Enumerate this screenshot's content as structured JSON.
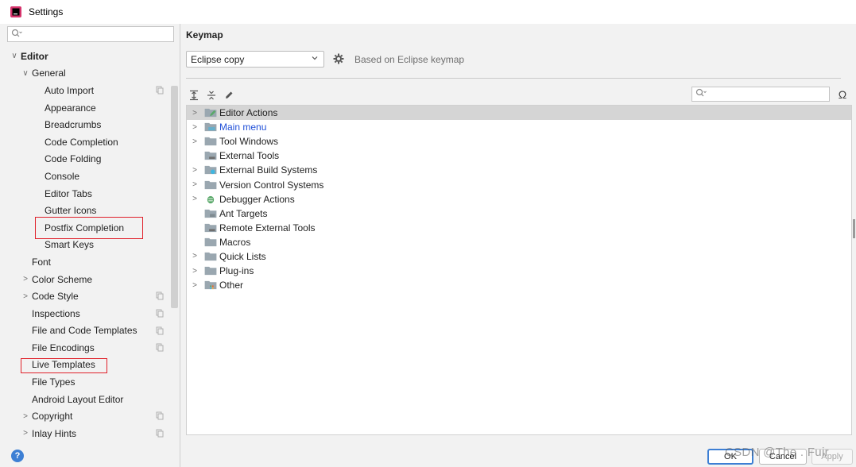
{
  "window": {
    "title": "Settings",
    "app_icon": "intellij-app-icon"
  },
  "left_panel": {
    "search_placeholder": "",
    "tree": [
      {
        "label": "Editor",
        "level": 0,
        "expanded": true,
        "bold": true,
        "copy_icon": false
      },
      {
        "label": "General",
        "level": 1,
        "expanded": true,
        "copy_icon": false
      },
      {
        "label": "Auto Import",
        "level": 2,
        "copy_icon": true
      },
      {
        "label": "Appearance",
        "level": 2,
        "copy_icon": false
      },
      {
        "label": "Breadcrumbs",
        "level": 2,
        "copy_icon": false
      },
      {
        "label": "Code Completion",
        "level": 2,
        "copy_icon": false
      },
      {
        "label": "Code Folding",
        "level": 2,
        "copy_icon": false
      },
      {
        "label": "Console",
        "level": 2,
        "copy_icon": false
      },
      {
        "label": "Editor Tabs",
        "level": 2,
        "copy_icon": false
      },
      {
        "label": "Gutter Icons",
        "level": 2,
        "copy_icon": false
      },
      {
        "label": "Postfix Completion",
        "level": 2,
        "copy_icon": false,
        "highlighted": true
      },
      {
        "label": "Smart Keys",
        "level": 2,
        "copy_icon": false
      },
      {
        "label": "Font",
        "level": 1,
        "copy_icon": false
      },
      {
        "label": "Color Scheme",
        "level": 1,
        "collapsed": true,
        "copy_icon": false
      },
      {
        "label": "Code Style",
        "level": 1,
        "collapsed": true,
        "copy_icon": true
      },
      {
        "label": "Inspections",
        "level": 1,
        "copy_icon": true
      },
      {
        "label": "File and Code Templates",
        "level": 1,
        "copy_icon": true
      },
      {
        "label": "File Encodings",
        "level": 1,
        "copy_icon": true
      },
      {
        "label": "Live Templates",
        "level": 1,
        "copy_icon": false,
        "highlighted": true
      },
      {
        "label": "File Types",
        "level": 1,
        "copy_icon": false
      },
      {
        "label": "Android Layout Editor",
        "level": 1,
        "copy_icon": false
      },
      {
        "label": "Copyright",
        "level": 1,
        "collapsed": true,
        "copy_icon": true
      },
      {
        "label": "Inlay Hints",
        "level": 1,
        "collapsed": true,
        "copy_icon": true
      }
    ]
  },
  "main": {
    "section_title": "Keymap",
    "keymap_select": {
      "value": "Eclipse copy"
    },
    "based_on": "Based on Eclipse keymap",
    "search_placeholder": "",
    "toolbar_icons": [
      "expand-all-icon",
      "collapse-all-icon",
      "edit-icon"
    ],
    "actions": [
      {
        "label": "Editor Actions",
        "has_children": true,
        "selected": true,
        "icon": "editor-folder-icon"
      },
      {
        "label": "Main menu",
        "has_children": true,
        "link": true,
        "icon": "menu-folder-icon"
      },
      {
        "label": "Tool Windows",
        "has_children": true,
        "icon": "folder-icon"
      },
      {
        "label": "External Tools",
        "has_children": false,
        "icon": "tools-folder-icon"
      },
      {
        "label": "External Build Systems",
        "has_children": true,
        "icon": "build-folder-icon"
      },
      {
        "label": "Version Control Systems",
        "has_children": true,
        "icon": "folder-icon"
      },
      {
        "label": "Debugger Actions",
        "has_children": true,
        "icon": "bug-icon"
      },
      {
        "label": "Ant Targets",
        "has_children": false,
        "icon": "ant-folder-icon"
      },
      {
        "label": "Remote External Tools",
        "has_children": false,
        "icon": "tools-folder-icon"
      },
      {
        "label": "Macros",
        "has_children": false,
        "icon": "folder-icon"
      },
      {
        "label": "Quick Lists",
        "has_children": true,
        "icon": "folder-icon"
      },
      {
        "label": "Plug-ins",
        "has_children": true,
        "icon": "folder-icon"
      },
      {
        "label": "Other",
        "has_children": true,
        "icon": "other-folder-icon"
      }
    ]
  },
  "footer": {
    "ok": "OK",
    "cancel": "Cancel",
    "apply": "Apply",
    "watermark": "CSDN @The . Fuir"
  },
  "colors": {
    "highlight": "#e0202a",
    "link": "#1f4fd8",
    "selected_row": "#d5d5d5",
    "accent": "#3d7fd4"
  }
}
